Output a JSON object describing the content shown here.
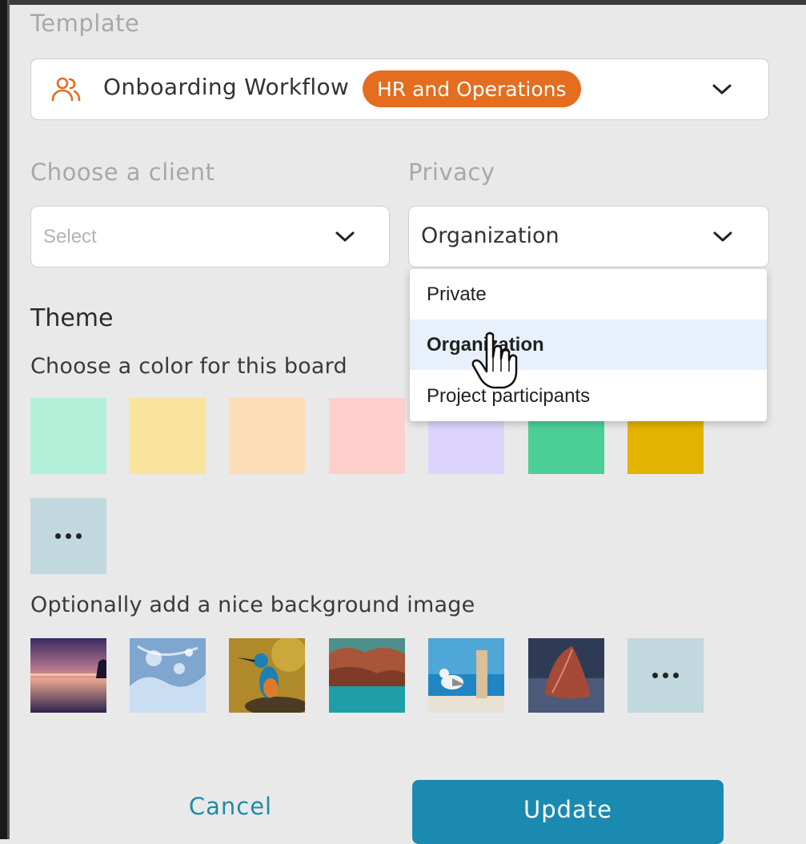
{
  "template": {
    "label": "Template",
    "name": "Onboarding Workflow",
    "badge": "HR and Operations",
    "icon": "users-icon"
  },
  "client": {
    "label": "Choose a client",
    "placeholder": "Select"
  },
  "privacy": {
    "label": "Privacy",
    "value": "Organization",
    "options": [
      "Private",
      "Organization",
      "Project participants"
    ],
    "selected_index": 1
  },
  "theme": {
    "heading": "Theme",
    "color_prompt": "Choose a color for this board",
    "colors": [
      "#b3f0d9",
      "#f8e49c",
      "#fdddb8",
      "#ffd0cb",
      "#dcd4fb",
      "#4dcf98",
      "#e2b300"
    ],
    "image_prompt": "Optionally add a nice background image",
    "images": [
      "sunset-lake",
      "water-splash",
      "kingfisher-bird",
      "rocky-coast",
      "seagull-beach",
      "autumn-leaf"
    ]
  },
  "actions": {
    "cancel": "Cancel",
    "update": "Update"
  },
  "colors": {
    "accent": "#1b8ab0",
    "badge": "#e46d1f",
    "icon": "#e46d1f"
  }
}
